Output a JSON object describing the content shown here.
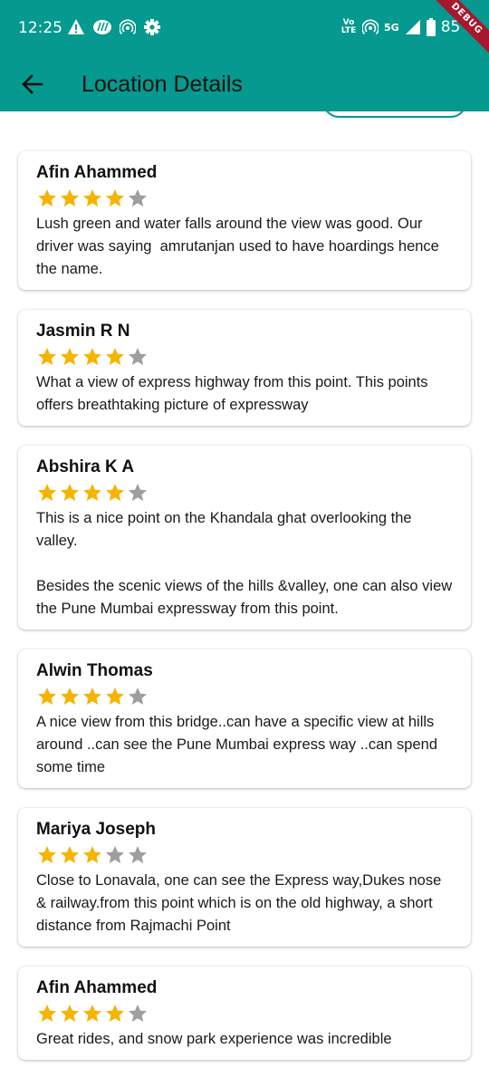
{
  "status_bar": {
    "time": "12:25",
    "network_label": "Vo LTE",
    "network_type": "5G",
    "battery": "85",
    "left_icons": [
      "alert-icon",
      "app-icon",
      "hotspot-icon",
      "settings-icon"
    ],
    "right_icons": [
      "volte-icon",
      "hotspot-icon",
      "signal-icon",
      "battery-icon"
    ]
  },
  "debug_banner": "DEBUG",
  "app_bar": {
    "title": "Location Details",
    "back_icon": "arrow-back-icon"
  },
  "colors": {
    "primary": "#05998f",
    "star_filled": "#f5b400",
    "star_empty": "#9e9e9e",
    "debug": "#a6182d"
  },
  "reviews": [
    {
      "name": "Afin Ahammed",
      "rating": 4,
      "text": "Lush green and water falls around the view was good. Our driver was saying  amrutanjan used to have hoardings hence the name."
    },
    {
      "name": "Jasmin R N",
      "rating": 4,
      "text": "What a view of express highway from this point. This points offers breathtaking picture of expressway"
    },
    {
      "name": "Abshira K A",
      "rating": 4,
      "text": "This is a nice point on the Khandala ghat overlooking the valley.\n\nBesides the scenic views of the hills &valley, one can also view the Pune Mumbai expressway from this point."
    },
    {
      "name": "Alwin Thomas",
      "rating": 4,
      "text": "A nice view from this bridge..can have a specific view at hills around ..can see the Pune Mumbai express way ..can spend some time"
    },
    {
      "name": "Mariya Joseph",
      "rating": 3,
      "text": "Close to Lonavala, one can see the Express way,Dukes nose  & railway.from this point which is on the old highway, a short distance from Rajmachi Point"
    },
    {
      "name": "Afin Ahammed",
      "rating": 4,
      "text": "Great rides, and snow park experience was incredible"
    }
  ]
}
